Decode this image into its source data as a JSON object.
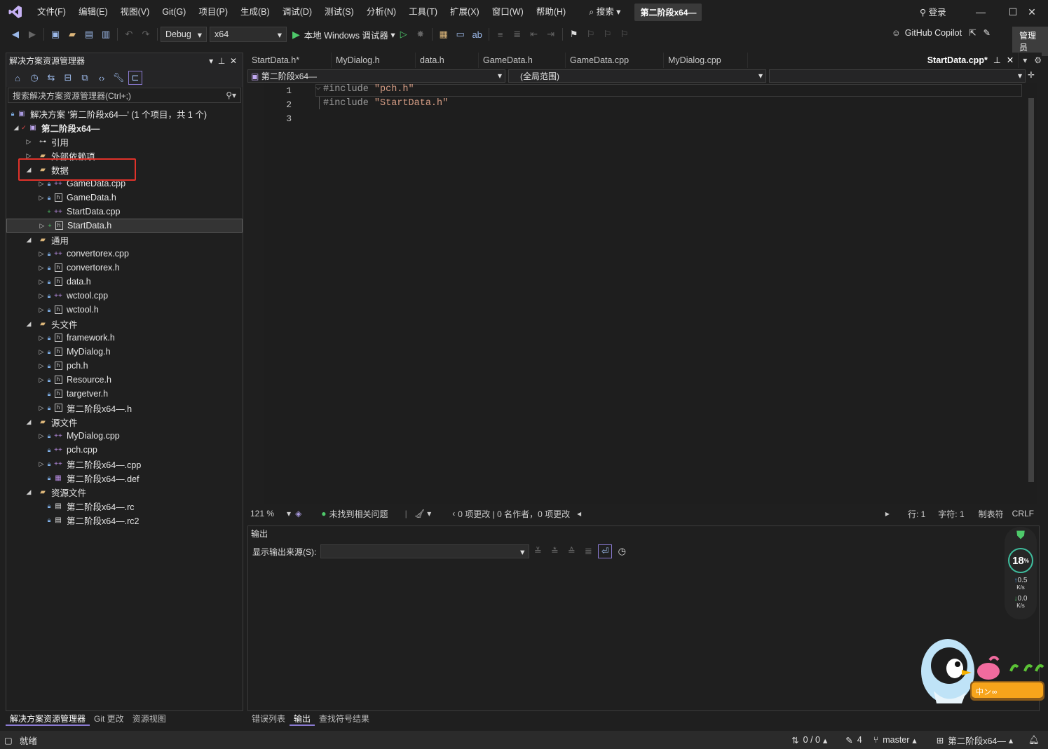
{
  "menu": {
    "items": [
      "文件(F)",
      "编辑(E)",
      "视图(V)",
      "Git(G)",
      "项目(P)",
      "生成(B)",
      "调试(D)",
      "测试(S)",
      "分析(N)",
      "工具(T)",
      "扩展(X)",
      "窗口(W)",
      "帮助(H)"
    ],
    "search": "搜索",
    "solution_chip": "第二阶段x64—",
    "signin": "登录"
  },
  "toolbar": {
    "config": "Debug",
    "platform": "x64",
    "debugger": "本地 Windows 调试器",
    "copilot": "GitHub Copilot",
    "admin": "管理员"
  },
  "solution_explorer": {
    "title": "解决方案资源管理器",
    "search_placeholder": "搜索解决方案资源管理器(Ctrl+;)",
    "solution_label": "解决方案 '第二阶段x64—' (1 个项目，共 1 个)",
    "project": "第二阶段x64—",
    "items": [
      {
        "label": "引用",
        "indent": 1,
        "arrow": "▷",
        "icon": "ref",
        "lock": false
      },
      {
        "label": "外部依赖项",
        "indent": 1,
        "arrow": "▷",
        "icon": "folder",
        "lock": false
      },
      {
        "label": "数据",
        "indent": 1,
        "arrow": "◢",
        "icon": "folder",
        "lock": false
      },
      {
        "label": "GameData.cpp",
        "indent": 2,
        "arrow": "▷",
        "icon": "cpp",
        "lock": true
      },
      {
        "label": "GameData.h",
        "indent": 2,
        "arrow": "▷",
        "icon": "h",
        "lock": true
      },
      {
        "label": "StartData.cpp",
        "indent": 2,
        "arrow": "",
        "icon": "cpp",
        "lock": false,
        "plus": true
      },
      {
        "label": "StartData.h",
        "indent": 2,
        "arrow": "▷",
        "icon": "h",
        "lock": false,
        "plus": true,
        "selected": true
      },
      {
        "label": "通用",
        "indent": 1,
        "arrow": "◢",
        "icon": "folder",
        "lock": false
      },
      {
        "label": "convertorex.cpp",
        "indent": 2,
        "arrow": "▷",
        "icon": "cpp",
        "lock": true
      },
      {
        "label": "convertorex.h",
        "indent": 2,
        "arrow": "▷",
        "icon": "h",
        "lock": true
      },
      {
        "label": "data.h",
        "indent": 2,
        "arrow": "▷",
        "icon": "h",
        "lock": true
      },
      {
        "label": "wctool.cpp",
        "indent": 2,
        "arrow": "▷",
        "icon": "cpp",
        "lock": true
      },
      {
        "label": "wctool.h",
        "indent": 2,
        "arrow": "▷",
        "icon": "h",
        "lock": true
      },
      {
        "label": "头文件",
        "indent": 1,
        "arrow": "◢",
        "icon": "folder",
        "lock": false
      },
      {
        "label": "framework.h",
        "indent": 2,
        "arrow": "▷",
        "icon": "h",
        "lock": true
      },
      {
        "label": "MyDialog.h",
        "indent": 2,
        "arrow": "▷",
        "icon": "h",
        "lock": true
      },
      {
        "label": "pch.h",
        "indent": 2,
        "arrow": "▷",
        "icon": "h",
        "lock": true
      },
      {
        "label": "Resource.h",
        "indent": 2,
        "arrow": "▷",
        "icon": "h",
        "lock": true
      },
      {
        "label": "targetver.h",
        "indent": 2,
        "arrow": "",
        "icon": "h",
        "lock": true
      },
      {
        "label": "第二阶段x64—.h",
        "indent": 2,
        "arrow": "▷",
        "icon": "h",
        "lock": true
      },
      {
        "label": "源文件",
        "indent": 1,
        "arrow": "◢",
        "icon": "folder",
        "lock": false
      },
      {
        "label": "MyDialog.cpp",
        "indent": 2,
        "arrow": "▷",
        "icon": "cpp",
        "lock": true
      },
      {
        "label": "pch.cpp",
        "indent": 2,
        "arrow": "",
        "icon": "cpp",
        "lock": true
      },
      {
        "label": "第二阶段x64—.cpp",
        "indent": 2,
        "arrow": "▷",
        "icon": "cpp",
        "lock": true
      },
      {
        "label": "第二阶段x64—.def",
        "indent": 2,
        "arrow": "",
        "icon": "def",
        "lock": true
      },
      {
        "label": "资源文件",
        "indent": 1,
        "arrow": "◢",
        "icon": "folder",
        "lock": false
      },
      {
        "label": "第二阶段x64—.rc",
        "indent": 2,
        "arrow": "",
        "icon": "rc",
        "lock": true
      },
      {
        "label": "第二阶段x64—.rc2",
        "indent": 2,
        "arrow": "",
        "icon": "rc",
        "lock": true
      }
    ],
    "bottom_tabs": [
      "解决方案资源管理器",
      "Git 更改",
      "资源视图"
    ]
  },
  "editor": {
    "tabs": [
      "StartData.h*",
      "MyDialog.h",
      "data.h",
      "GameData.h",
      "GameData.cpp",
      "MyDialog.cpp"
    ],
    "active_tab": "StartData.cpp*",
    "nav_project": "第二阶段x64—",
    "nav_scope": "(全局范围)",
    "lines": [
      {
        "num": "1",
        "pre": "#include ",
        "str": "\"pch.h\""
      },
      {
        "num": "2",
        "pre": "#include ",
        "str": "\"StartData.h\""
      },
      {
        "num": "3",
        "pre": "",
        "str": ""
      }
    ],
    "zoom": "121 %",
    "issues": "未找到相关问题",
    "changes": "0 项更改 | 0 名作者，0 项更改",
    "line": "行: 1",
    "col": "字符: 1",
    "tabs_mode": "制表符",
    "eol": "CRLF"
  },
  "output": {
    "title": "输出",
    "source_label": "显示输出来源(S):",
    "bottom_tabs": [
      "错误列表",
      "输出",
      "查找符号结果"
    ]
  },
  "meter": {
    "cpu": "18",
    "cpu_unit": "%",
    "up": "0.5",
    "down": "0.0",
    "rate_unit": "K/s"
  },
  "mascot": {
    "text": "中ン∞"
  },
  "statusbar": {
    "ready": "就绪",
    "sync": "0 / 0",
    "edits": "4",
    "branch": "master",
    "repo": "第二阶段x64—"
  }
}
